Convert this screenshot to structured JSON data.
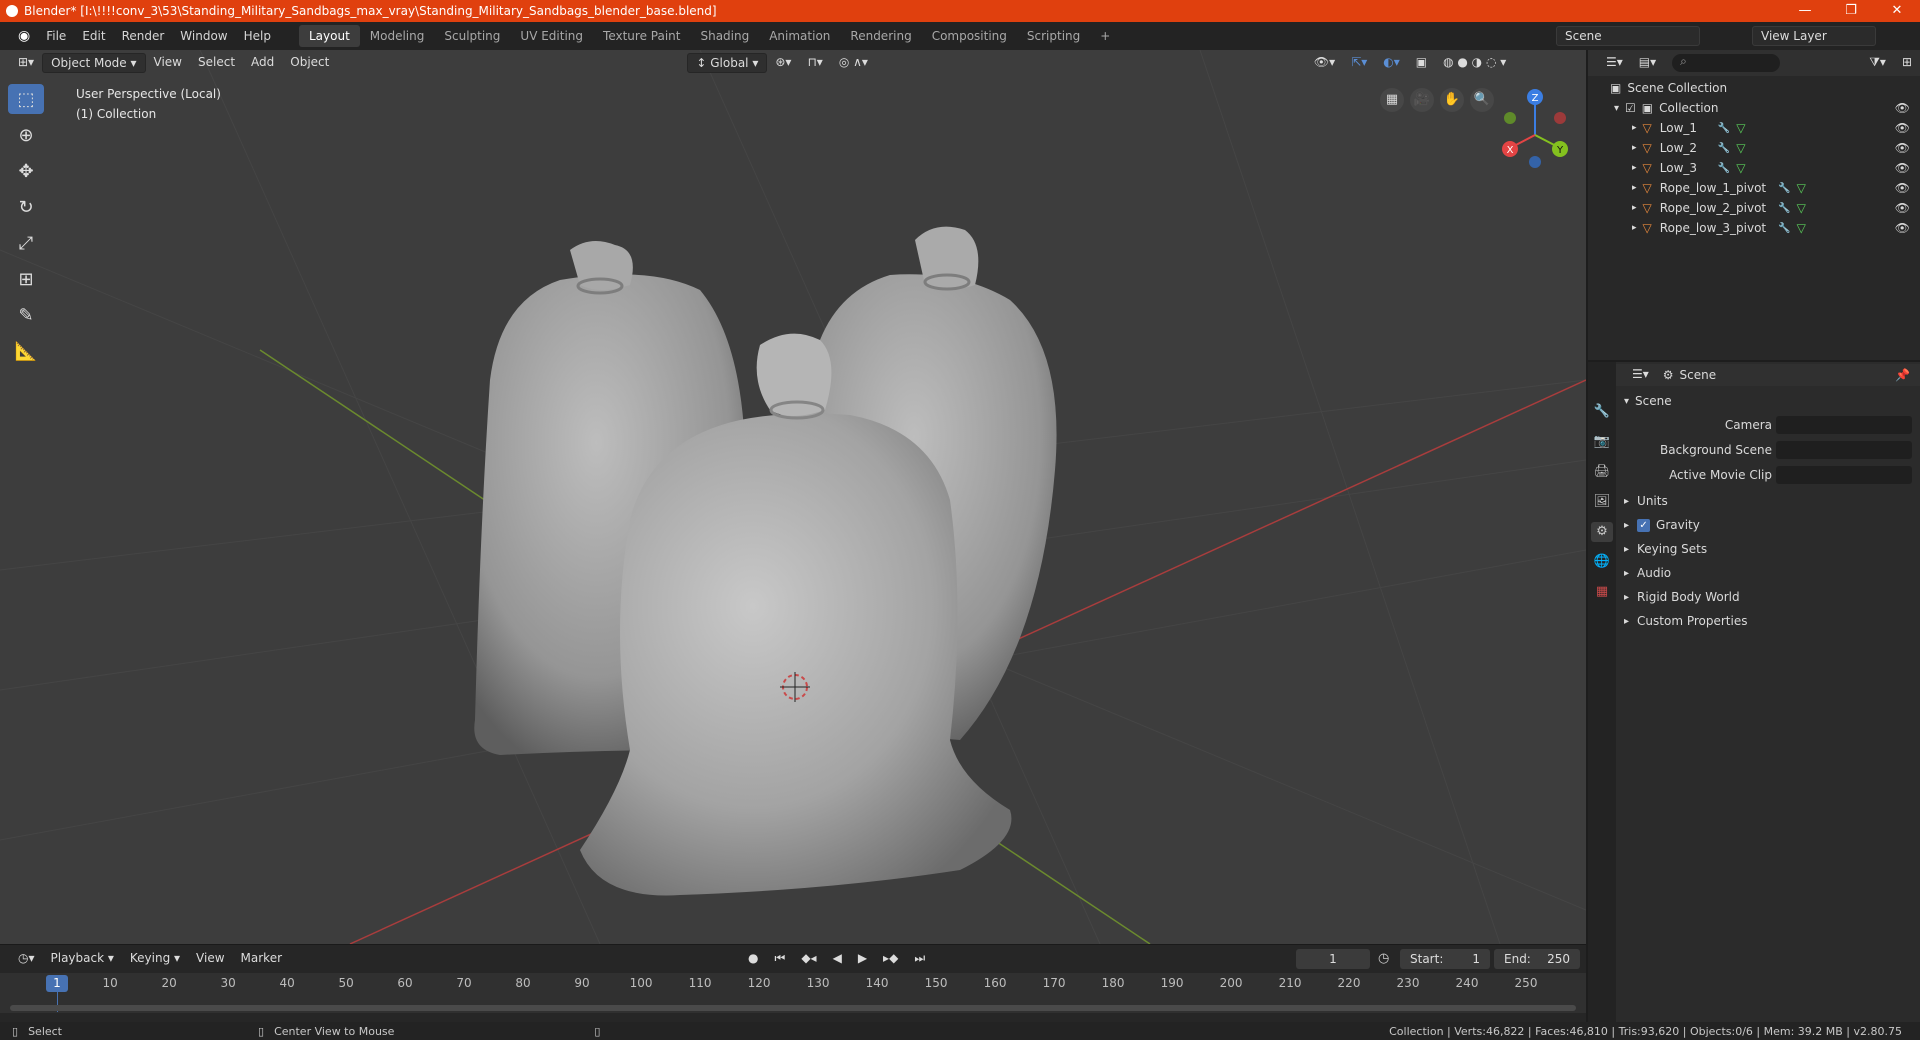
{
  "window": {
    "title": "Blender* [I:\\!!!!conv_3\\53\\Standing_Military_Sandbags_max_vray\\Standing_Military_Sandbags_blender_base.blend]",
    "controls": [
      "—",
      "❐",
      "✕"
    ]
  },
  "menu": {
    "items": [
      "File",
      "Edit",
      "Render",
      "Window",
      "Help"
    ],
    "workspaces": [
      "Layout",
      "Modeling",
      "Sculpting",
      "UV Editing",
      "Texture Paint",
      "Shading",
      "Animation",
      "Rendering",
      "Compositing",
      "Scripting"
    ],
    "active_workspace": "Layout",
    "add_tab": "+",
    "scene": "Scene",
    "view_layer": "View Layer"
  },
  "viewport": {
    "mode": "Object Mode",
    "menus": [
      "View",
      "Select",
      "Add",
      "Object"
    ],
    "orientation": "Global",
    "info_line1": "User Perspective (Local)",
    "info_line2": "(1) Collection",
    "gizmo": {
      "x": "X",
      "y": "Y",
      "z": "Z"
    }
  },
  "outliner": {
    "root": "Scene Collection",
    "collection": "Collection",
    "objects": [
      "Low_1",
      "Low_2",
      "Low_3",
      "Rope_low_1_pivot",
      "Rope_low_2_pivot",
      "Rope_low_3_pivot"
    ]
  },
  "properties": {
    "header": "Scene",
    "panel": "Scene",
    "fields": [
      {
        "label": "Camera"
      },
      {
        "label": "Background Scene"
      },
      {
        "label": "Active Movie Clip"
      }
    ],
    "sections": [
      "Units",
      "Gravity",
      "Keying Sets",
      "Audio",
      "Rigid Body World",
      "Custom Properties"
    ]
  },
  "timeline": {
    "menus": [
      "Playback",
      "Keying",
      "View",
      "Marker"
    ],
    "current_frame": "1",
    "start_label": "Start:",
    "start": "1",
    "end_label": "End:",
    "end": "250",
    "ticks": [
      "10",
      "20",
      "30",
      "40",
      "50",
      "60",
      "70",
      "80",
      "90",
      "100",
      "110",
      "120",
      "130",
      "140",
      "150",
      "160",
      "170",
      "180",
      "190",
      "200",
      "210",
      "220",
      "230",
      "240",
      "250"
    ]
  },
  "status": {
    "left": "Select",
    "middle": "Center View to Mouse",
    "right": "Collection | Verts:46,822 | Faces:46,810 | Tris:93,620 | Objects:0/6 | Mem: 39.2 MB | v2.80.75"
  },
  "colors": {
    "title_bar": "#e0400e",
    "accent": "#4772b3",
    "viewport_bg": "#3d3d3d",
    "object_icon": "#e8893c",
    "mesh_icon": "#5ad05a"
  }
}
